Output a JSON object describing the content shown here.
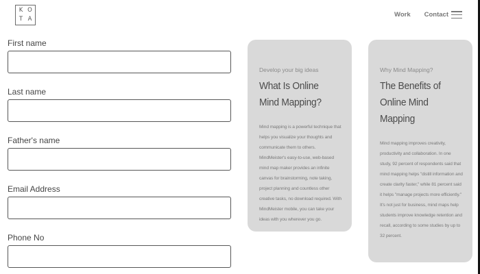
{
  "header": {
    "logo_letters": [
      "K",
      "O",
      "T",
      "A"
    ],
    "nav": {
      "work_label": "Work",
      "contact_label": "Contact"
    }
  },
  "form": {
    "fields": [
      {
        "label": "First name",
        "value": ""
      },
      {
        "label": "Last name",
        "value": ""
      },
      {
        "label": "Father's name",
        "value": ""
      },
      {
        "label": "Email Address",
        "value": ""
      },
      {
        "label": "Phone No",
        "value": ""
      }
    ]
  },
  "cards": [
    {
      "eyebrow": "Develop your big ideas",
      "title": "What Is Online Mind Mapping?",
      "body": "Mind mapping is a powerful technique that helps you visualize your thoughts and communicate them to others. MindMeister's easy-to-use, web-based mind map maker provides an infinite canvas for brainstorming, note taking, project planning and countless other creative tasks, no download required. With MindMeister mobile, you can take your ideas with you wherever you go."
    },
    {
      "eyebrow": "Why Mind Mapping?",
      "title": "The Benefits of Online Mind Mapping",
      "body": "Mind mapping improves creativity, productivity and collaboration. In one study, 92 percent of respondents said that mind mapping helps \"distill information and create clarity faster,\" while 81 percent said it helps \"manage projects more efficiently.\" It's not just for business, mind maps help students improve knowledge retention and recall, according to some studies by up to 32 percent."
    }
  ]
}
